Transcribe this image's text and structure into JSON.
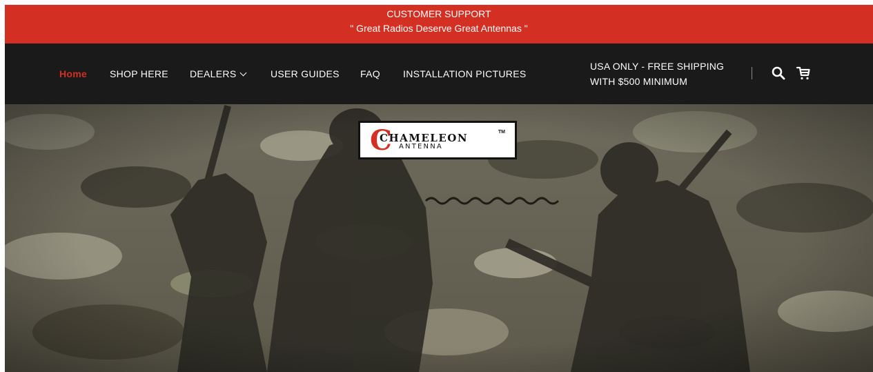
{
  "announcement": {
    "line1": "CUSTOMER SUPPORT",
    "line2": "\" Great Radios Deserve Great Antennas \""
  },
  "nav": {
    "items": [
      {
        "label": "Home",
        "active": true
      },
      {
        "label": "SHOP HERE"
      },
      {
        "label": "DEALERS"
      },
      {
        "label": "USER GUIDES"
      },
      {
        "label": "FAQ"
      },
      {
        "label": "INSTALLATION PICTURES"
      }
    ],
    "shipping_line1": "USA ONLY - FREE SHIPPING",
    "shipping_line2": "WITH $500 MINIMUM",
    "icons": [
      "search-icon",
      "cart-icon"
    ]
  },
  "hero": {
    "logo": {
      "mark": "C",
      "word": "CHAMELEON",
      "tm": "TM",
      "sub": "ANTENNA"
    }
  },
  "colors": {
    "brand_red": "#d32f23",
    "nav_bg": "#1a1a1a",
    "active_link": "#d32f23"
  }
}
